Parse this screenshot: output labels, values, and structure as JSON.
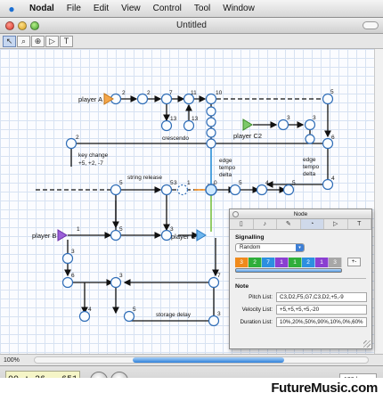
{
  "menubar": {
    "app_name": "Nodal",
    "items": [
      "File",
      "Edit",
      "View",
      "Control",
      "Tool",
      "Window"
    ]
  },
  "window": {
    "title": "Untitled"
  },
  "toolbar": {
    "tools": [
      {
        "name": "arrow-tool-icon",
        "glyph": "↖"
      },
      {
        "name": "zoom-tool-icon",
        "glyph": "⌕"
      },
      {
        "name": "zoom-region-tool-icon",
        "glyph": "⊕"
      },
      {
        "name": "play-tool-icon",
        "glyph": "▷"
      },
      {
        "name": "text-tool-icon",
        "glyph": "T"
      }
    ]
  },
  "canvas": {
    "player_labels": [
      "player A",
      "player B",
      "player C",
      "player C2"
    ],
    "annotations": [
      "crescendo",
      "key change",
      "+5, +2, -7",
      "string release",
      "edge",
      "tempo",
      "delta",
      "storage delay"
    ],
    "node_numbers": [
      "2",
      "2",
      "7",
      "11",
      "10",
      "13",
      "13",
      "5",
      "3",
      "3",
      "6",
      "2",
      "5",
      "5",
      "3",
      "1",
      "0",
      "5",
      "4",
      "5",
      "4",
      "5",
      "3",
      "1",
      "3",
      "6",
      "3",
      "3",
      "7",
      "4",
      "5",
      "3",
      "2",
      "3",
      "3"
    ]
  },
  "zoom_level": "100%",
  "transport": {
    "time": "00 : 26 . 651",
    "tempo": "120 bpm"
  },
  "node_panel": {
    "title": "Node",
    "tabs": [
      "page-tab-icon",
      "note-tab-icon",
      "pen-tab-icon",
      "signal-tab-icon",
      "play-tab-icon",
      "text-tab-icon"
    ],
    "signalling_title": "Signalling",
    "mode": "Random",
    "sequence": [
      {
        "value": "3",
        "color": "#f08a1c"
      },
      {
        "value": "2",
        "color": "#2fae3a"
      },
      {
        "value": "7",
        "color": "#2c8fe0"
      },
      {
        "value": "1",
        "color": "#8a3fd1"
      },
      {
        "value": "1",
        "color": "#2fae3a"
      },
      {
        "value": "2",
        "color": "#2c8fe0"
      },
      {
        "value": "1",
        "color": "#8a3fd1"
      },
      {
        "value": "3",
        "color": "#a7a7a7"
      }
    ],
    "plus_minus": "+-",
    "note_title": "Note",
    "fields": [
      {
        "label": "Pitch List:",
        "value": "C3,D2,F5,G7,C3,D2,+5,-9"
      },
      {
        "label": "Velocity List:",
        "value": "+5,+5,+5,+5,-20"
      },
      {
        "label": "Duration List:",
        "value": "10%,20%,50%,90%,10%,0%,60%"
      }
    ]
  },
  "footer": {
    "brand": "FutureMusic.com"
  },
  "colors": {
    "node_stroke": "#2f6db7",
    "player_orange": "#f4a64a",
    "player_purple": "#9b5fd9",
    "player_blue": "#6fb6ee",
    "player_green": "#7cc96b"
  }
}
